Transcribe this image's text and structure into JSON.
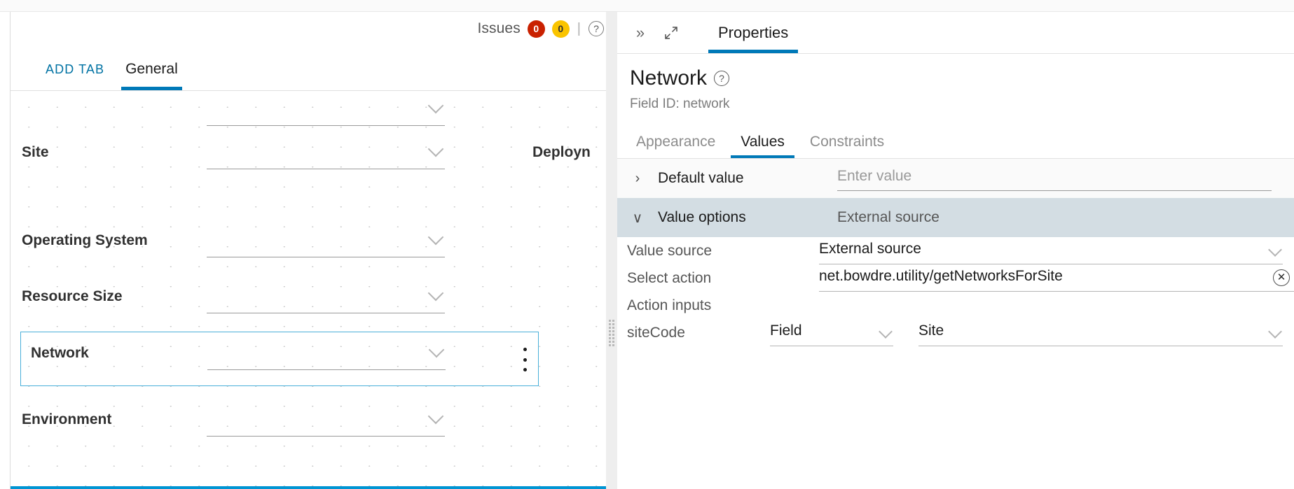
{
  "left_panel": {
    "issues": {
      "label": "Issues",
      "error_count": "0",
      "warning_count": "0",
      "divider": "|",
      "help_icon": "?"
    },
    "tabs": [
      {
        "label": "ADD TAB",
        "active": false
      },
      {
        "label": "General",
        "active": true
      }
    ],
    "canvas_fields": [
      {
        "label": "Site",
        "right_overflow": "Deployn"
      },
      {
        "label": "Operating System",
        "right_overflow": ""
      },
      {
        "label": "Resource Size",
        "right_overflow": ""
      },
      {
        "label": "Network",
        "right_overflow": "",
        "selected": true
      },
      {
        "label": "Environment",
        "right_overflow": ""
      }
    ]
  },
  "right_panel": {
    "collapse_icon": "»",
    "expand_icon": "expand-arrows",
    "tabs": [
      {
        "label": "Properties",
        "active": true
      }
    ],
    "field_title": "Network",
    "field_title_help": "?",
    "field_id": "Field ID: network",
    "subtabs": [
      {
        "label": "Appearance",
        "active": false
      },
      {
        "label": "Values",
        "active": true
      },
      {
        "label": "Constraints",
        "active": false
      }
    ],
    "accordion": {
      "default_value": {
        "chevron": "›",
        "label": "Default value",
        "input_placeholder": "Enter value"
      },
      "value_options": {
        "chevron": "∨",
        "label": "Value options",
        "summary": "External source"
      }
    },
    "detail": {
      "value_source_label": "Value source",
      "value_source_value": "External source",
      "select_action_label": "Select action",
      "select_action_value": "net.bowdre.utility/getNetworksForSite",
      "select_action_clear": "✕",
      "action_inputs_label": "Action inputs",
      "site_code_label": "siteCode",
      "site_code_type": "Field",
      "site_code_value": "Site"
    }
  },
  "colors": {
    "accent_blue": "#0079b8",
    "link_blue": "#0072a3",
    "selection_border": "#49afd9",
    "error_red": "#c92100",
    "warning_yellow": "#fac400",
    "row_highlight": "#d3dde3",
    "bottom_accent": "#0095d3"
  }
}
